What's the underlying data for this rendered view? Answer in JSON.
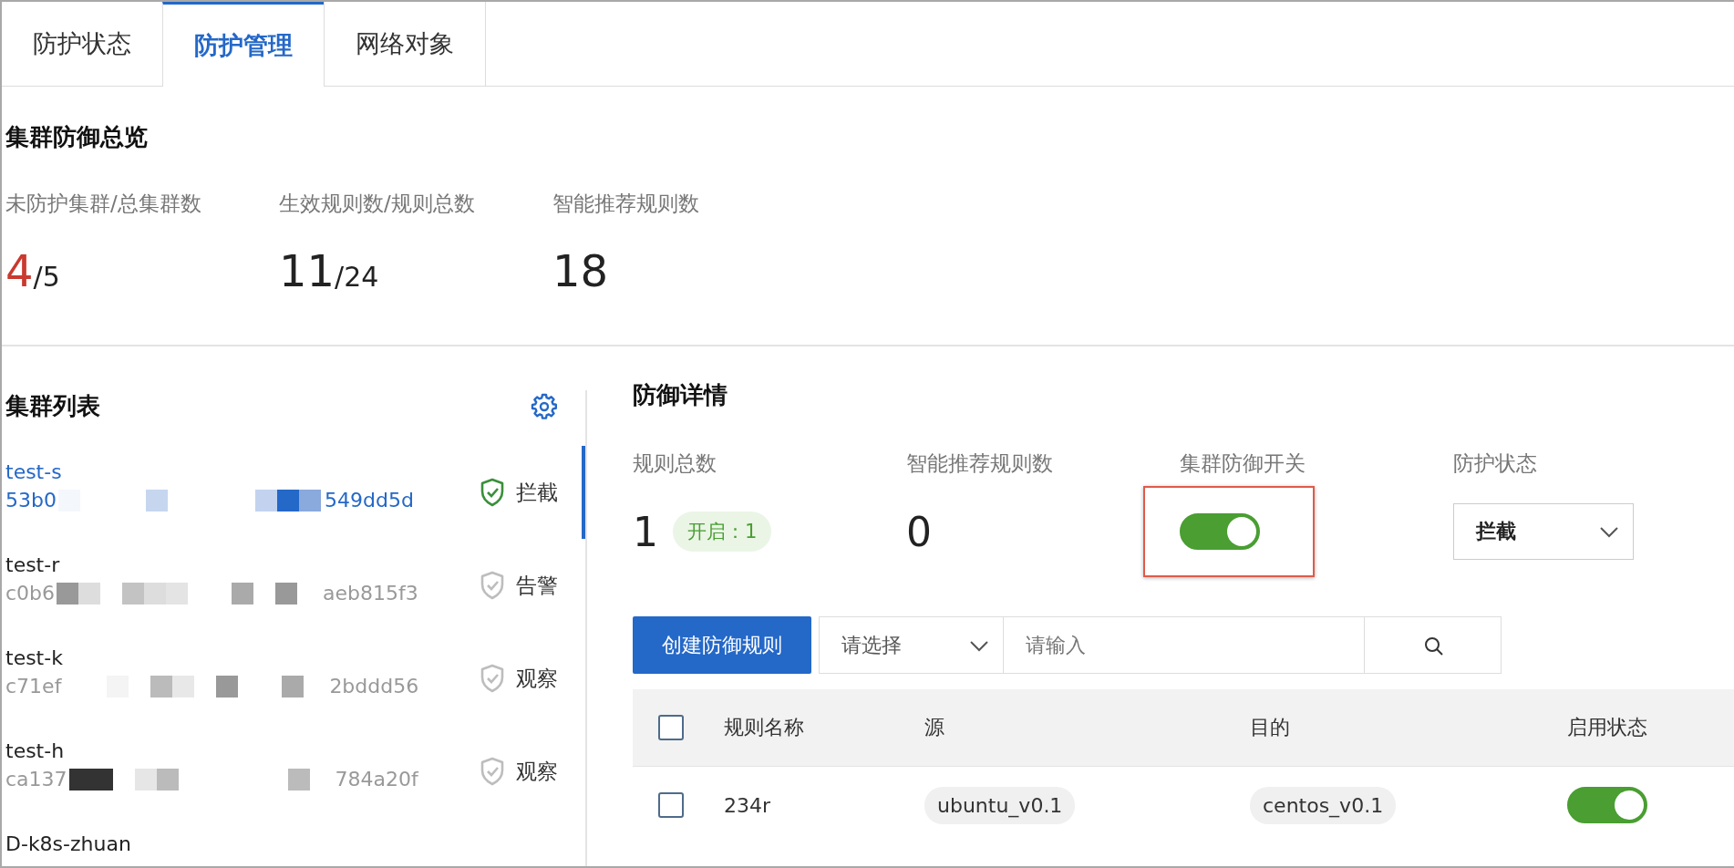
{
  "tabs": [
    {
      "label": "防护状态",
      "selected": false
    },
    {
      "label": "防护管理",
      "selected": true
    },
    {
      "label": "网络对象",
      "selected": false
    }
  ],
  "overview": {
    "title": "集群防御总览",
    "stats": [
      {
        "label": "未防护集群/总集群数",
        "value": "4",
        "total": "/5",
        "alert": true
      },
      {
        "label": "生效规则数/规则总数",
        "value": "11",
        "total": "/24",
        "alert": false
      },
      {
        "label": "智能推荐规则数",
        "value": "18",
        "alert": false
      }
    ]
  },
  "cluster_list": {
    "title": "集群列表",
    "items": [
      {
        "name": "test-s",
        "id_start": "53b0",
        "id_end": "549dd5d",
        "status": "拦截",
        "protected": true,
        "selected": true
      },
      {
        "name": "test-r",
        "id_start": "c0b6",
        "id_end": "aeb815f3",
        "status": "告警",
        "protected": false,
        "selected": false
      },
      {
        "name": "test-k",
        "id_start": "c71ef",
        "id_end": "2bddd56",
        "status": "观察",
        "protected": false,
        "selected": false
      },
      {
        "name": "test-h",
        "id_start": "ca137",
        "id_end": "784a20f",
        "status": "观察",
        "protected": false,
        "selected": false
      },
      {
        "name": "D-k8s-zhuan",
        "selected": false
      }
    ]
  },
  "detail": {
    "title": "防御详情",
    "rule_total_label": "规则总数",
    "rule_total": "1",
    "enabled_badge": "开启：1",
    "recommended_label": "智能推荐规则数",
    "recommended": "0",
    "switch_label": "集群防御开关",
    "switch_on": true,
    "switch_highlighted": true,
    "mode_label": "防护状态",
    "mode": "拦截"
  },
  "toolbar": {
    "create_button": "创建防御规则",
    "filter_placeholder": "请选择",
    "search_placeholder": "请输入"
  },
  "table": {
    "all_checked": false,
    "columns": [
      "规则名称",
      "源",
      "目的",
      "启用状态"
    ],
    "rows": [
      {
        "checked": false,
        "name": "234r",
        "source": "ubuntu_v0.1",
        "destination": "centos_v0.1",
        "enabled": true
      }
    ]
  }
}
